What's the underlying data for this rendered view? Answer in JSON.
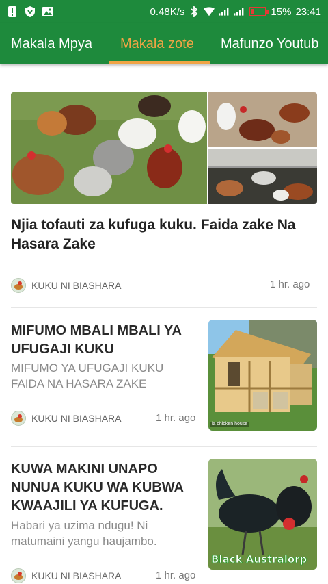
{
  "status_bar": {
    "left_icons": [
      "alert-icon",
      "shield-icon",
      "image-icon"
    ],
    "network_speed": "0.48K/s",
    "battery": "15%",
    "time": "23:41"
  },
  "tabs": [
    {
      "label": "Makala Mpya",
      "active": false
    },
    {
      "label": "Makala zote",
      "active": true
    },
    {
      "label": "Mafunzo Youtub",
      "active": false
    }
  ],
  "colors": {
    "app_bar": "#1e8a3c",
    "tab_active": "#f0a445",
    "battery_low": "#e53935"
  },
  "featured": {
    "title": "Njia tofauti za kufuga kuku. Faida zake Na Hasara Zake",
    "author": "KUKU NI BIASHARA",
    "time": "1 hr. ago"
  },
  "articles": [
    {
      "title": "MIFUMO MBALI MBALI YA UFUGAJI KUKU",
      "subtitle": "MIFUMO YA UFUGAJI KUKU FAIDA NA HASARA  ZAKE",
      "author": "KUKU NI BIASHARA",
      "time": "1 hr. ago",
      "thumb_caption": "la chicken house"
    },
    {
      "title": "KUWA MAKINI UNAPO NUNUA KUKU WA KUBWA KWAAJILI YA KUFUGA.",
      "subtitle": "Habari ya  uzima ndugu! Ni matumaini yangu haujambo.",
      "author": "KUKU NI BIASHARA",
      "time": "1 hr. ago",
      "thumb_caption": "Black Australorp"
    }
  ]
}
